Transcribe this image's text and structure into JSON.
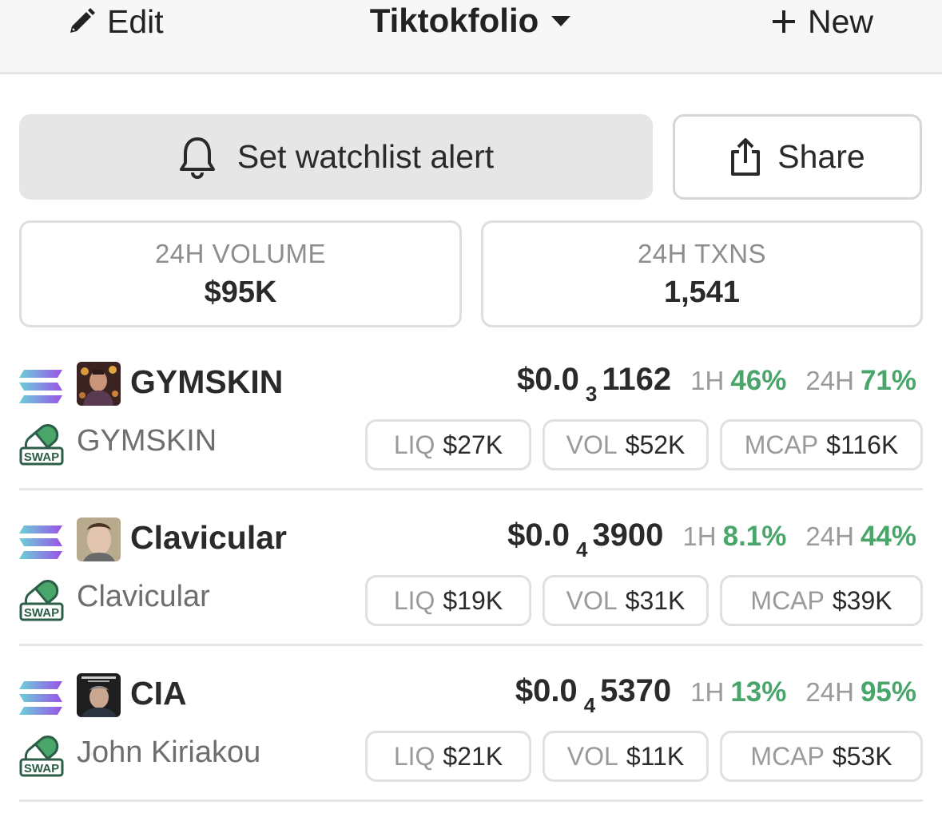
{
  "header": {
    "edit_label": "Edit",
    "title": "Tiktokfolio",
    "new_label": "New"
  },
  "actions": {
    "alert_label": "Set watchlist alert",
    "share_label": "Share"
  },
  "stats": [
    {
      "label": "24H VOLUME",
      "value": "$95K"
    },
    {
      "label": "24H TXNS",
      "value": "1,541"
    }
  ],
  "tokens": [
    {
      "symbol": "GYMSKIN",
      "name": "GYMSKIN",
      "price_prefix": "$0.0",
      "price_zeros": "3",
      "price_digits": "1162",
      "h1_label": "1H",
      "h1_change": "46%",
      "h24_label": "24H",
      "h24_change": "71%",
      "liq_label": "LIQ",
      "liq": "$27K",
      "vol_label": "VOL",
      "vol": "$52K",
      "mcap_label": "MCAP",
      "mcap": "$116K"
    },
    {
      "symbol": "Clavicular",
      "name": "Clavicular",
      "price_prefix": "$0.0",
      "price_zeros": "4",
      "price_digits": "3900",
      "h1_label": "1H",
      "h1_change": "8.1%",
      "h24_label": "24H",
      "h24_change": "44%",
      "liq_label": "LIQ",
      "liq": "$19K",
      "vol_label": "VOL",
      "vol": "$31K",
      "mcap_label": "MCAP",
      "mcap": "$39K"
    },
    {
      "symbol": "CIA",
      "name": "John Kiriakou",
      "price_prefix": "$0.0",
      "price_zeros": "4",
      "price_digits": "5370",
      "h1_label": "1H",
      "h1_change": "13%",
      "h24_label": "24H",
      "h24_change": "95%",
      "liq_label": "LIQ",
      "liq": "$21K",
      "vol_label": "VOL",
      "vol": "$11K",
      "mcap_label": "MCAP",
      "mcap": "$53K"
    }
  ],
  "swap_badge": "SWAP",
  "icons": {
    "edit": "pencil-icon",
    "title_dropdown": "caret-down-icon",
    "new": "plus-icon",
    "alert": "bell-icon",
    "share": "share-icon",
    "chain": "solana-icon",
    "dex": "pill-swap-icon"
  },
  "colors": {
    "positive": "#4aa56b",
    "muted": "#9a9a9a",
    "alert_button_bg": "#e6e6e6"
  }
}
